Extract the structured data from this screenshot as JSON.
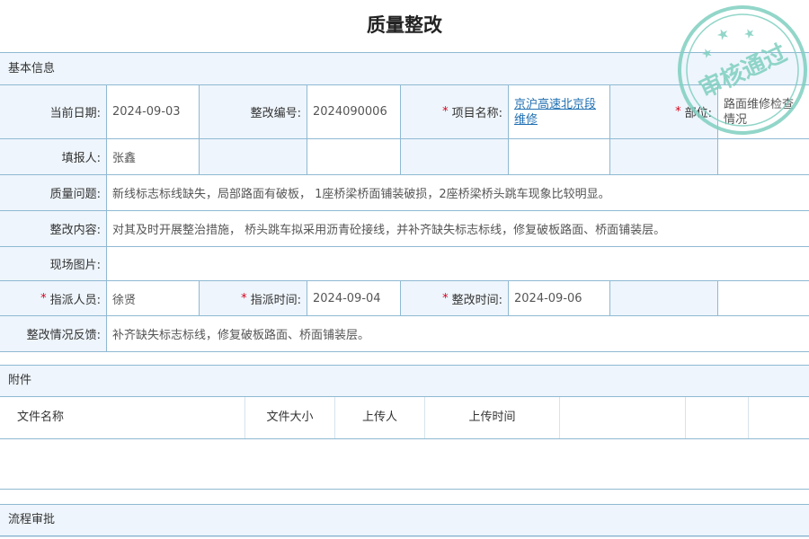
{
  "page": {
    "title": "质量整改"
  },
  "sections": {
    "basic": "基本信息",
    "attachments": "附件",
    "workflow": "流程审批"
  },
  "form": {
    "date_label": "当前日期:",
    "date_value": "2024-09-03",
    "number_label": "整改编号:",
    "number_value": "2024090006",
    "project_label": "项目名称:",
    "project_value": "京沪高速北京段维修",
    "part_label": "部位:",
    "part_value": "路面维修检查情况",
    "reporter_label": "填报人:",
    "reporter_value": "张鑫",
    "issue_label": "质量问题:",
    "issue_value": "新线标志标线缺失，局部路面有破板， 1座桥梁桥面铺装破损，2座桥梁桥头跳车现象比较明显。",
    "content_label": "整改内容:",
    "content_value": "对其及时开展整治措施， 桥头跳车拟采用沥青砼接线，并补齐缺失标志标线，修复破板路面、桥面铺装层。",
    "photo_label": "现场图片:",
    "assignee_label": "指派人员:",
    "assignee_value": "徐贤",
    "assign_time_label": "指派时间:",
    "assign_time_value": "2024-09-04",
    "fix_time_label": "整改时间:",
    "fix_time_value": "2024-09-06",
    "feedback_label": "整改情况反馈:",
    "feedback_value": "补齐缺失标志标线，修复破板路面、桥面铺装层。",
    "required_mark": "*"
  },
  "attachments": {
    "columns": [
      "文件名称",
      "文件大小",
      "上传人",
      "上传时间"
    ]
  },
  "stamp": {
    "text": "审核通过",
    "color": "#7fcfc0"
  },
  "colors": {
    "border": "#8fb9d3",
    "label_bg": "#eef5fc",
    "link": "#1f6fb2",
    "required": "#d9001b"
  }
}
